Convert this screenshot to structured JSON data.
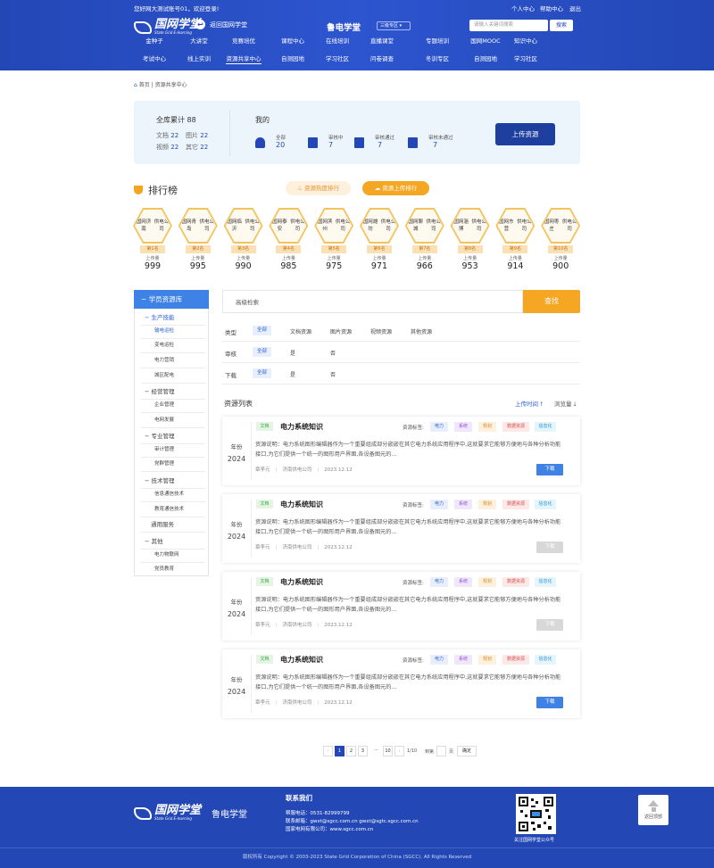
{
  "topbar": {
    "greeting": "您好网大测试账号01，欢迎登录!",
    "personal": "个人中心",
    "help": "帮助中心",
    "logout": "退出"
  },
  "header": {
    "logo_cn": "国网学堂",
    "logo_en": "State Grid E-learning",
    "back_label": "返回国网学堂",
    "site_name": "鲁电学堂",
    "zone_label": "三级专区",
    "search_placeholder": "请输入关键词搜索",
    "search_button": "搜索"
  },
  "nav_row1": [
    "金种子",
    "大讲堂",
    "竞赛培优",
    "课程中心",
    "在线培训",
    "直播课堂",
    "专题培训",
    "国网MOOC",
    "知识中心"
  ],
  "nav_row2": [
    "考试中心",
    "线上实训",
    "资源共享中心",
    "自测园地",
    "学习社区",
    "问卷调查",
    "冬训专区",
    "自测园地",
    "学习社区"
  ],
  "breadcrumb": {
    "home": "首页",
    "current": "资源共享中心"
  },
  "stats": {
    "total_label": "全库累计",
    "total": "88",
    "doc_label": "文档",
    "doc": "22",
    "img_label": "图片",
    "img": "22",
    "video_label": "视频",
    "video": "22",
    "other_label": "其它",
    "other": "22",
    "mine_label": "我的",
    "mine": [
      {
        "label": "全部",
        "value": "20",
        "icon": "cloud-upload-icon"
      },
      {
        "label": "审核中",
        "value": "7",
        "icon": "doc-pending-icon"
      },
      {
        "label": "审核通过",
        "value": "7",
        "icon": "doc-approved-icon"
      },
      {
        "label": "审核未通过",
        "value": "7",
        "icon": "doc-rejected-icon"
      }
    ],
    "upload_button": "上传资源"
  },
  "ranking": {
    "title": "排行榜",
    "hot_button": "资源热度排行",
    "upload_button": "资源上传排行",
    "upload_label": "上传量",
    "items": [
      {
        "line1": "国网济南",
        "line2": "供电公司",
        "rank": "第1名",
        "value": "999"
      },
      {
        "line1": "国网青岛",
        "line2": "供电公司",
        "rank": "第2名",
        "value": "995"
      },
      {
        "line1": "国网临沂",
        "line2": "供电公司",
        "rank": "第3名",
        "value": "990"
      },
      {
        "line1": "国网泰安",
        "line2": "供电公司",
        "rank": "第4名",
        "value": "985"
      },
      {
        "line1": "国网滨州",
        "line2": "供电公司",
        "rank": "第5名",
        "value": "975"
      },
      {
        "line1": "国网潍坊",
        "line2": "供电公司",
        "rank": "第6名",
        "value": "971"
      },
      {
        "line1": "国网聊城",
        "line2": "供电公司",
        "rank": "第7名",
        "value": "966"
      },
      {
        "line1": "国网淄博",
        "line2": "供电公司",
        "rank": "第8名",
        "value": "953"
      },
      {
        "line1": "国网东营",
        "line2": "供电公司",
        "rank": "第9名",
        "value": "914"
      },
      {
        "line1": "国网枣庄",
        "line2": "供电公司",
        "rank": "第10名",
        "value": "900"
      }
    ]
  },
  "sidebar": {
    "title": "学员资源库",
    "items": [
      {
        "label": "生产技能",
        "level": 1,
        "active": true
      },
      {
        "label": "输电运检",
        "level": 2,
        "active": true
      },
      {
        "label": "变电运检",
        "level": 2
      },
      {
        "label": "电力营销",
        "level": 2
      },
      {
        "label": "城区配电",
        "level": 2
      },
      {
        "label": "经营管理",
        "level": 1
      },
      {
        "label": "企业管理",
        "level": 2
      },
      {
        "label": "电网发展",
        "level": 2
      },
      {
        "label": "专业管理",
        "level": 1
      },
      {
        "label": "审计管理",
        "level": 2
      },
      {
        "label": "党群管理",
        "level": 2
      },
      {
        "label": "技术管理",
        "level": 1
      },
      {
        "label": "信息通信技术",
        "level": 2
      },
      {
        "label": "教育通信技术",
        "level": 2
      },
      {
        "label": "通用服务",
        "level": 0
      },
      {
        "label": "其他",
        "level": 1
      },
      {
        "label": "电力物联网",
        "level": 2
      },
      {
        "label": "党员教育",
        "level": 2
      }
    ]
  },
  "filter": {
    "advanced_label": "高级检索",
    "find_button": "查找",
    "type_label": "类型",
    "type_options": [
      "全部",
      "文档资源",
      "图片资源",
      "视频资源",
      "其他资源"
    ],
    "audit_label": "审核",
    "audit_options": [
      "全部",
      "是",
      "否"
    ],
    "download_label": "下载",
    "download_options": [
      "全部",
      "是",
      "否"
    ]
  },
  "list": {
    "title": "资源列表",
    "sort_time": "上传时间",
    "sort_views": "浏览量",
    "tag_prefix": "资源标签:",
    "year_label": "年份",
    "download_label": "下载",
    "items": [
      {
        "year": "2024",
        "type": "文档",
        "title": "电力系统知识",
        "tags": [
          "电力",
          "系统",
          "规划",
          "数据资源",
          "信息化"
        ],
        "desc": "资源说明：电力系统图形编辑器作为一个重要组成部分嵌嵌在其它电力系统应用程序中,这就要求它能够方便地与各种分析功能接口,为它们提供一个统一的图形用户界面,各设备图元的...",
        "author": "章李元",
        "org": "济南供电公司",
        "date": "2023.12.12",
        "download_enabled": true
      },
      {
        "year": "2024",
        "type": "文档",
        "title": "电力系统知识",
        "tags": [
          "电力",
          "系统",
          "规划",
          "数据资源",
          "信息化"
        ],
        "desc": "资源说明：电力系统图形编辑器作为一个重要组成部分嵌嵌在其它电力系统应用程序中,这就要求它能够方便地与各种分析功能接口,为它们提供一个统一的图形用户界面,各设备图元的...",
        "author": "章李元",
        "org": "济南供电公司",
        "date": "2023.12.12",
        "download_enabled": false
      },
      {
        "year": "2024",
        "type": "文档",
        "title": "电力系统知识",
        "tags": [
          "电力",
          "系统",
          "规划",
          "数据资源",
          "信息化"
        ],
        "desc": "资源说明：电力系统图形编辑器作为一个重要组成部分嵌嵌在其它电力系统应用程序中,这就要求它能够方便地与各种分析功能接口,为它们提供一个统一的图形用户界面,各设备图元的...",
        "author": "章李元",
        "org": "济南供电公司",
        "date": "2023.12.12",
        "download_enabled": false
      },
      {
        "year": "2024",
        "type": "文档",
        "title": "电力系统知识",
        "tags": [
          "电力",
          "系统",
          "规划",
          "数据资源",
          "信息化"
        ],
        "desc": "资源说明：电力系统图形编辑器作为一个重要组成部分嵌嵌在其它电力系统应用程序中,这就要求它能够方便地与各种分析功能接口,为它们提供一个统一的图形用户界面,各设备图元的...",
        "author": "章李元",
        "org": "济南供电公司",
        "date": "2023.12.12",
        "download_enabled": true
      }
    ]
  },
  "pager": {
    "prev": "‹",
    "pages": [
      "1",
      "2",
      "3",
      "···",
      "10"
    ],
    "next": "›",
    "page_info": "1/10",
    "goto_label": "到第",
    "page_unit": "页",
    "confirm": "确定"
  },
  "footer": {
    "logo_cn": "国网学堂",
    "logo_en": "State Grid E-learning",
    "site_name": "鲁电学堂",
    "contact_title": "联系我们",
    "phone": "帮服电话：0531-82999799",
    "email": "联系邮箱：gwxt@sgcc.com.cn    gwxt@sgtc.sgcc.com.cn",
    "company": "国家电网有限公司：www.sgcc.com.cn",
    "qr_label": "关注国网学堂公众号",
    "back_top": "返回顶部",
    "copyright": "版权所有 Copyright © 2003-2023 State Grid Corporation of China (SGCC). All Rights Reserved"
  },
  "colors": {
    "primary": "#2447b6",
    "accent": "#f5a623",
    "link": "#2a62d6",
    "download": "#3e82e6",
    "download_disabled": "#d8d8d8"
  }
}
